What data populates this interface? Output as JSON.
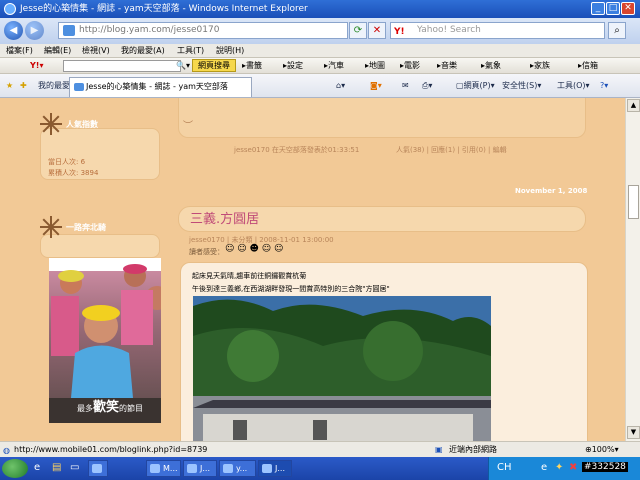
{
  "window": {
    "title": "Jesse的心築情集 - 網誌 - yam天空部落 - Windows Internet Explorer"
  },
  "address": {
    "url": "http://blog.yam.com/jesse0170",
    "search_placeholder": "Yahoo! Search"
  },
  "menu": [
    "檔案(F)",
    "編輯(E)",
    "檢視(V)",
    "我的最愛(A)",
    "工具(T)",
    "說明(H)"
  ],
  "yahoo_toolbar": {
    "web_search_label": "網頁搜尋",
    "items": [
      "書籤",
      "設定",
      "汽車",
      "地圖",
      "電影",
      "音樂",
      "氣象",
      "家族",
      "信箱"
    ]
  },
  "tabs": {
    "favorites_label": "我的最愛",
    "active_tab": "Jesse的心築情集 - 網誌 - yam天空部落",
    "commands": [
      "網頁(P)",
      "安全性(S)",
      "工具(O)"
    ]
  },
  "sidebar": {
    "popularity_title": "人氣指數",
    "today_visits": "當日人次: 6",
    "total_visits": "累積人次: 3894",
    "section2_title": "一路奔北騎",
    "photo_caption_pre": "最多",
    "photo_caption_big": "歡笑",
    "photo_caption_post": "的節目"
  },
  "previous_post": {
    "footer": "jesse0170 在天空部落發表於01:33:51",
    "links": "人氣(38) | 回應(1) | 引用(0) | 編輯"
  },
  "post": {
    "date_header": "November 1, 2008",
    "title": "三義.方圓居",
    "meta": "jesse0170 | 未分類 | 2008-11-01 13:00:00",
    "mood_label": "讀者感受：",
    "line1": "起床見天氣晴,趨車前往銅鑼觀賞杭菊",
    "line2": "午後到達三義鄉,在西湖湖畔發現一間賞高特別的三合院\"方圓居\""
  },
  "status": {
    "url": "http://www.mobile01.com/bloglink.php?id=8739",
    "zone": "近端內部網路",
    "zoom": "100%"
  },
  "taskbar": {
    "items": [
      "M...",
      "J...",
      "y...",
      "J..."
    ],
    "tray_id": "#332528"
  },
  "colors": {
    "page_bg": "#f2c996",
    "title_pink": "#c04b78",
    "meta_brown": "#b8855a"
  }
}
